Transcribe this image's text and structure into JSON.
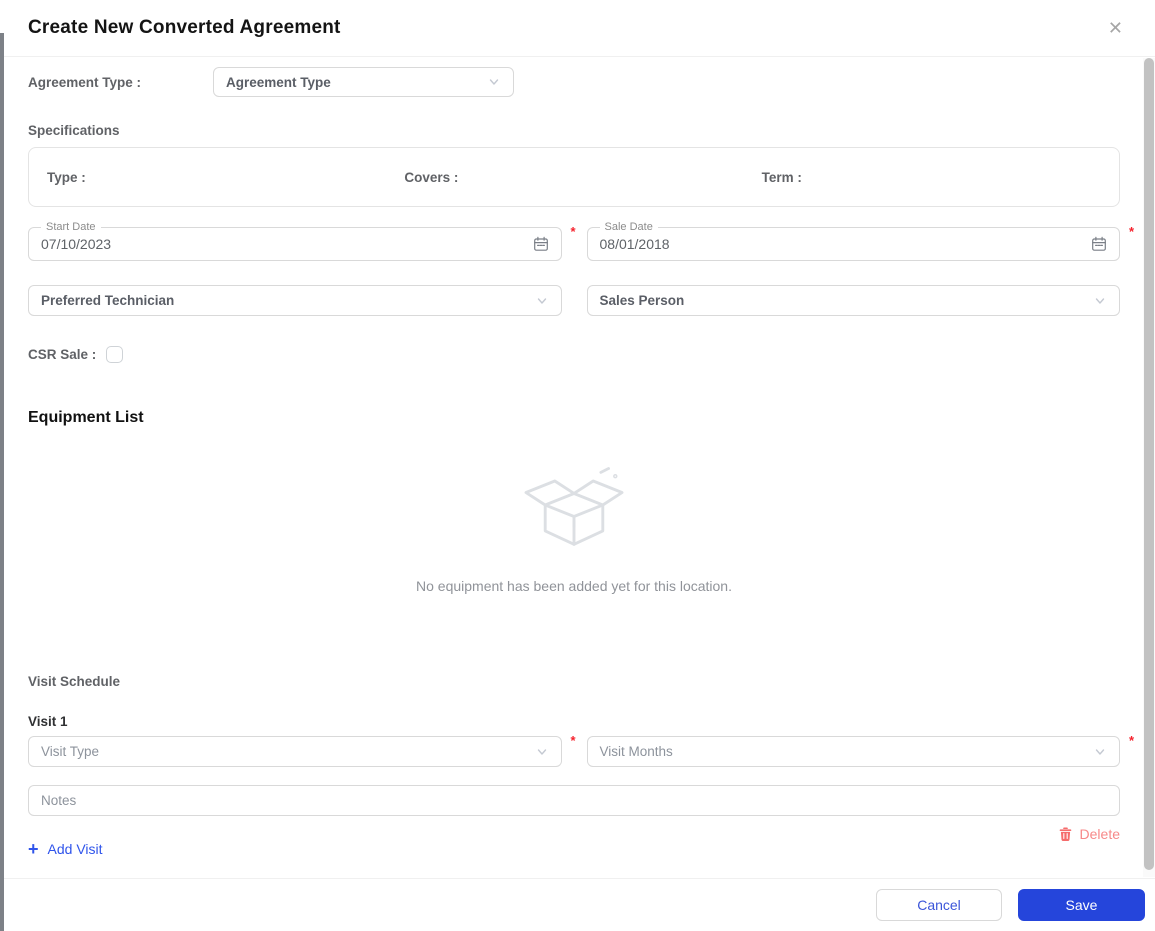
{
  "modal": {
    "title": "Create New Converted Agreement",
    "close_icon": "✕"
  },
  "common": {
    "required_marker": "*"
  },
  "agreement": {
    "label": "Agreement Type :",
    "dropdown_placeholder": "Agreement Type"
  },
  "specifications": {
    "section_label": "Specifications",
    "type_label": "Type :",
    "covers_label": "Covers :",
    "term_label": "Term :"
  },
  "dates": {
    "start": {
      "label": "Start Date",
      "value": "07/10/2023"
    },
    "sale": {
      "label": "Sale Date",
      "value": "08/01/2018"
    }
  },
  "people": {
    "preferred_technician_placeholder": "Preferred Technician",
    "sales_person_placeholder": "Sales Person"
  },
  "csr": {
    "label": "CSR Sale :"
  },
  "equipment": {
    "heading": "Equipment List",
    "empty_message": "No equipment has been added yet for this location."
  },
  "visit_schedule": {
    "section_label": "Visit Schedule",
    "visit_title": "Visit 1",
    "visit_type_placeholder": "Visit Type",
    "visit_months_placeholder": "Visit Months",
    "notes_placeholder": "Notes",
    "add_icon": "+",
    "add_visit_label": "Add Visit",
    "delete_label": "Delete"
  },
  "footer": {
    "cancel_label": "Cancel",
    "save_label": "Save"
  },
  "colors": {
    "accent_blue": "#2545db",
    "link_blue": "#2f54eb",
    "delete_red": "#f56c6c",
    "required_red": "#f5222d"
  }
}
